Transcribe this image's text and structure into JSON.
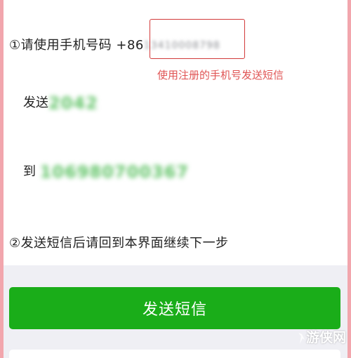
{
  "step1": {
    "text": "①请使用手机号码 +86",
    "phone_blurred": "13410008798"
  },
  "annotation": {
    "text": "使用注册的手机号发送短信",
    "color": "#e05454"
  },
  "send_field": {
    "label": "发送",
    "value_blurred": "2042"
  },
  "to_field": {
    "label": "到",
    "value_blurred": "106980700367"
  },
  "step2": {
    "text": "②发送短信后请回到本界面继续下一步"
  },
  "send_button": {
    "label": "发送短信",
    "color": "#1aad19"
  },
  "watermark": {
    "text": "游侠网"
  },
  "colors": {
    "page_border": "#f2a6ad",
    "highlight_box": "#d23a3a",
    "grey_background": "#efeff4"
  }
}
